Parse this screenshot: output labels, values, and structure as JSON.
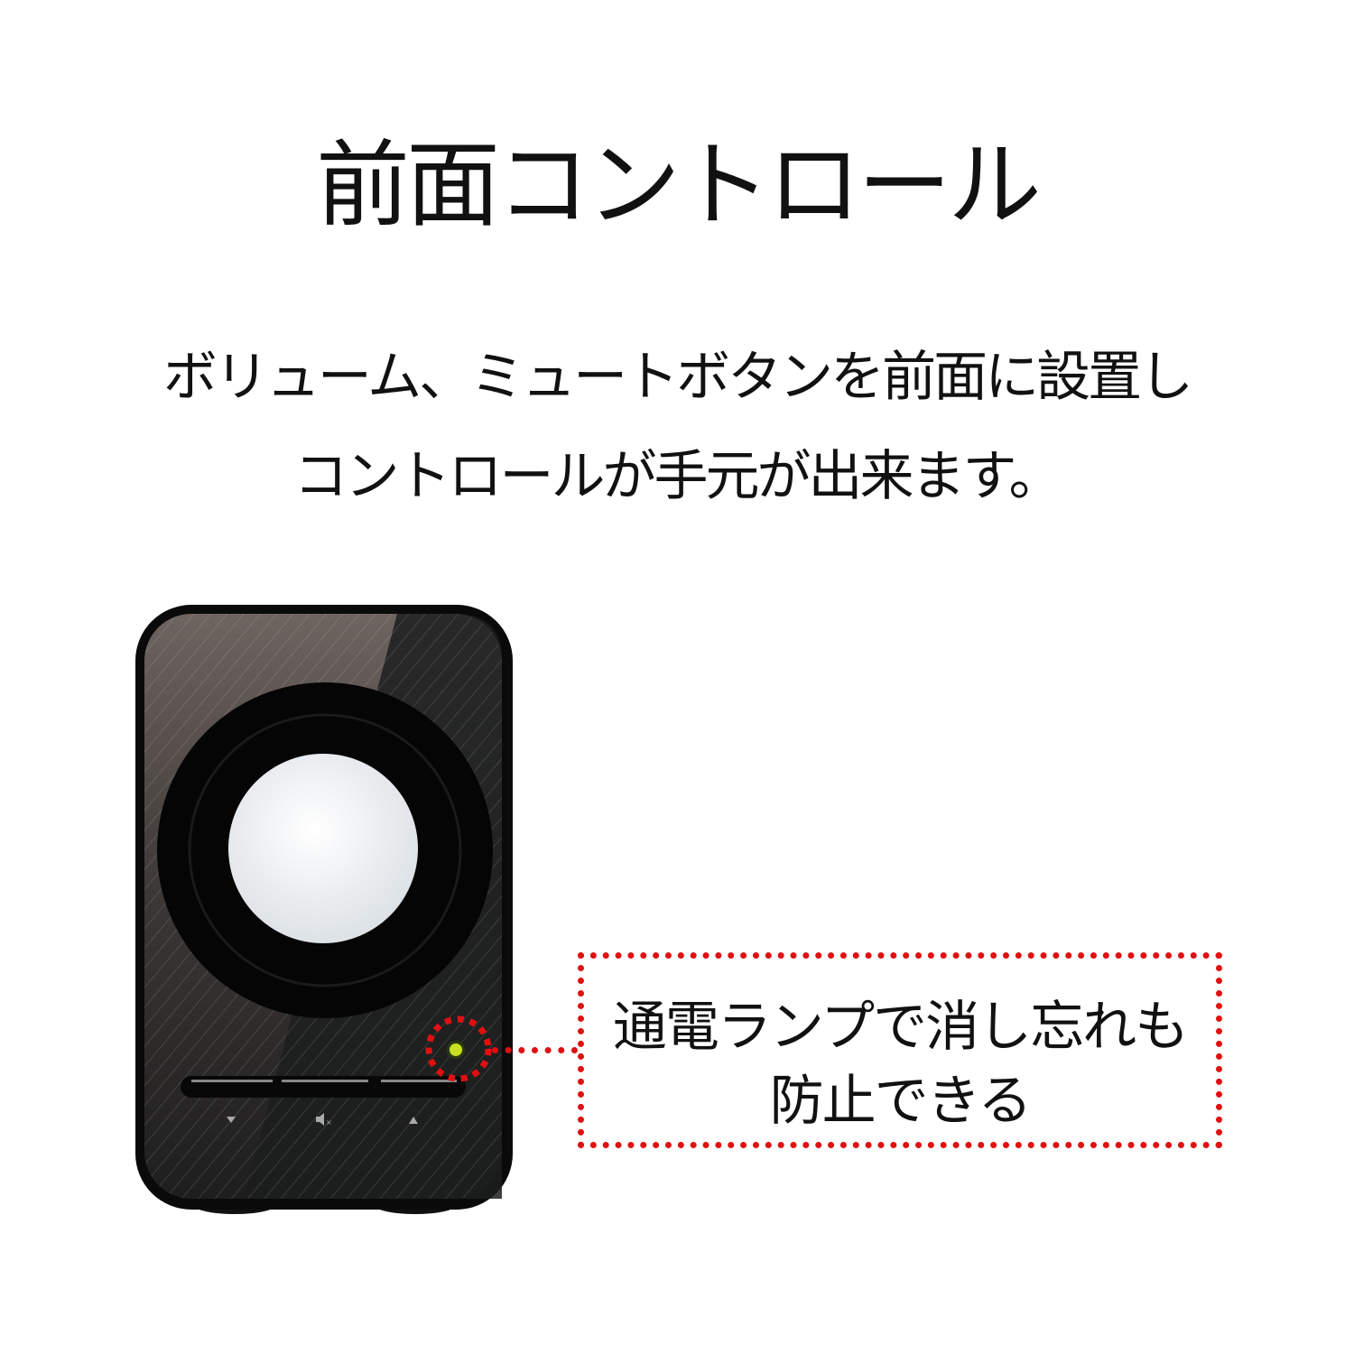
{
  "title": "前面コントロール",
  "description": {
    "line1": "ボリューム、ミュートボタンを前面に設置し",
    "line2": "コントロールが手元が出来ます。"
  },
  "callout": {
    "line1": "通電ランプで消し忘れも",
    "line2": "防止できる"
  },
  "speaker": {
    "buttons": [
      {
        "icon": "volume-down-icon"
      },
      {
        "icon": "mute-icon"
      },
      {
        "icon": "volume-up-icon"
      }
    ],
    "power_lamp_color": "#c8e020",
    "highlight_color": "#e01010"
  }
}
